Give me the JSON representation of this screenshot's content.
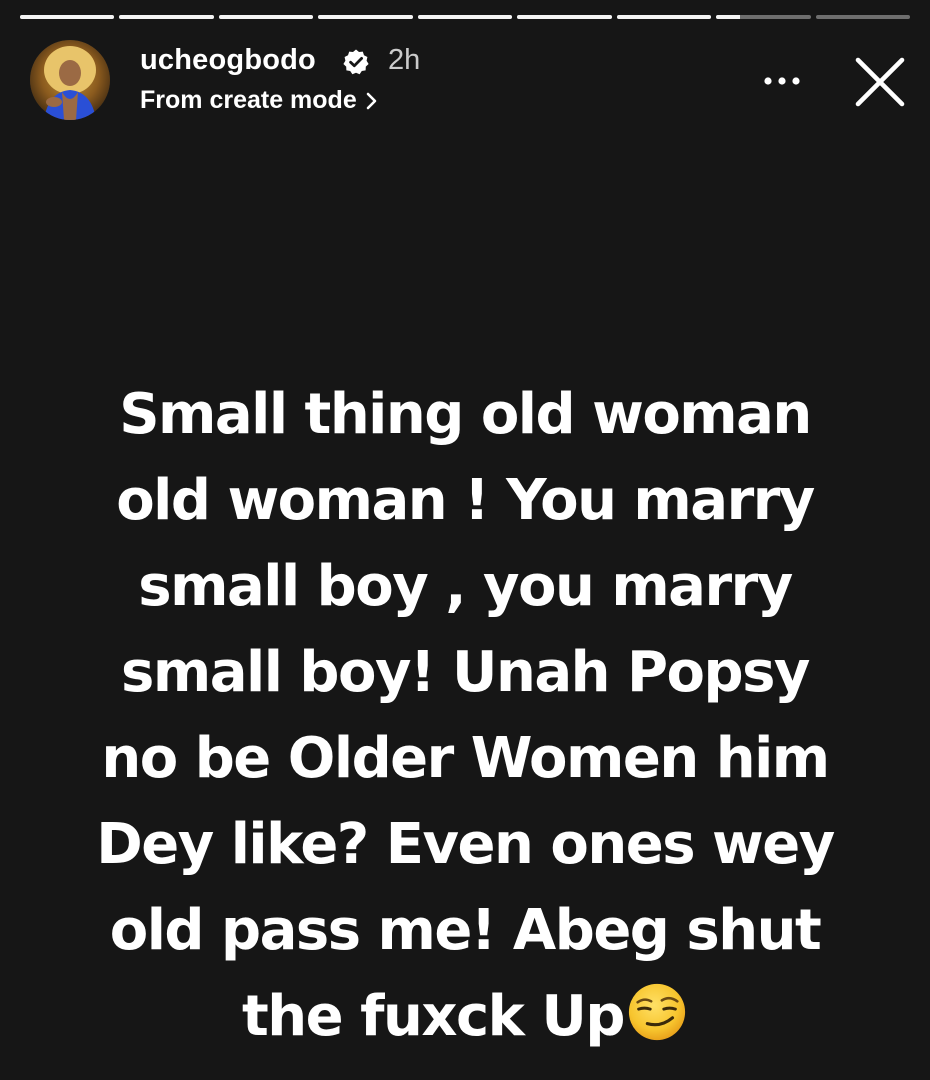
{
  "story": {
    "progress": {
      "segments": [
        1,
        1,
        1,
        1,
        1,
        1,
        1,
        0.25,
        0
      ],
      "note_unit": "fraction viewed"
    },
    "author": {
      "username": "ucheogbodo",
      "verified": true,
      "time_ago": "2h",
      "subtitle": "From create mode"
    },
    "icons": {
      "avatar": "profile-avatar",
      "verified": "verified-badge-icon",
      "subtitle_chevron": "chevron-right-icon",
      "more": "more-options-icon",
      "close": "close-icon",
      "emoji": "smirking-face-emoji"
    },
    "text_lines": [
      "Small thing old woman",
      "old woman ! You marry",
      "small boy , you marry",
      "small boy! Unah Popsy",
      "no be Older Women him",
      "Dey like? Even ones wey",
      "old pass me! Abeg shut",
      "the fuxck Up"
    ],
    "colors": {
      "background": "#161616",
      "text": "#ffffff",
      "emoji_face": "#f7c52e"
    }
  }
}
